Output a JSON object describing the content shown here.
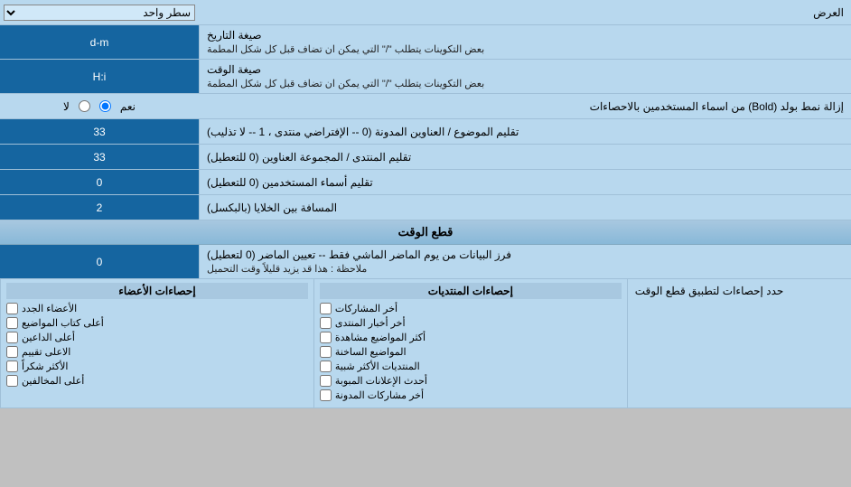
{
  "page": {
    "title": "العرض",
    "sections": {
      "top_select": {
        "label": "العرض",
        "options": [
          "سطر واحد"
        ],
        "selected": "سطر واحد"
      },
      "date_format": {
        "label": "صيغة التاريخ",
        "sublabel": "بعض التكوينات يتطلب \"/\" التي يمكن ان تضاف قبل كل شكل المطمة",
        "value": "d-m"
      },
      "time_format": {
        "label": "صيغة الوقت",
        "sublabel": "بعض التكوينات يتطلب \"/\" التي يمكن ان تضاف قبل كل شكل المطمة",
        "value": "H:i"
      },
      "bold_radio": {
        "label": "إزالة نمط بولد (Bold) من اسماء المستخدمين بالاحصاءات",
        "options": [
          "نعم",
          "لا"
        ],
        "selected": "نعم"
      },
      "topic_order": {
        "label": "تقليم الموضوع / العناوين المدونة (0 -- الإفتراضي منتدى ، 1 -- لا تذليب)",
        "value": "33"
      },
      "forum_order": {
        "label": "تقليم المنتدى / المجموعة العناوين (0 للتعطيل)",
        "value": "33"
      },
      "username_trim": {
        "label": "تقليم أسماء المستخدمين (0 للتعطيل)",
        "value": "0"
      },
      "cell_spacing": {
        "label": "المسافة بين الخلايا (بالبكسل)",
        "value": "2"
      },
      "cutoff_section": {
        "header": "قطع الوقت",
        "label_main": "حدد إحصاءات لتطبيق قطع الوقت",
        "cutoff_label": "فرز البيانات من يوم الماضر الماشي فقط -- تعيين الماضر (0 لتعطيل)",
        "cutoff_note": "ملاحظة : هذا قد يزيد قليلاً وقت التحميل",
        "cutoff_value": "0"
      },
      "stats_columns": {
        "col1_header": "إحصاءات المنتديات",
        "col2_header": "إحصاءات الأعضاء",
        "col1_items": [
          "أخر المشاركات",
          "أخر أخبار المنتدى",
          "أكثر المواضيع مشاهدة",
          "المواضيع الساخنة",
          "المنتديات الأكثر شبية",
          "أحدث الإعلانات المبوبة",
          "أخر مشاركات المدونة"
        ],
        "col2_items": [
          "الأعضاء الجدد",
          "أعلى كتاب المواضيع",
          "أعلى الداعين",
          "الاعلى تقييم",
          "الأكثر شكراً",
          "أعلى المخالفين"
        ]
      }
    }
  }
}
